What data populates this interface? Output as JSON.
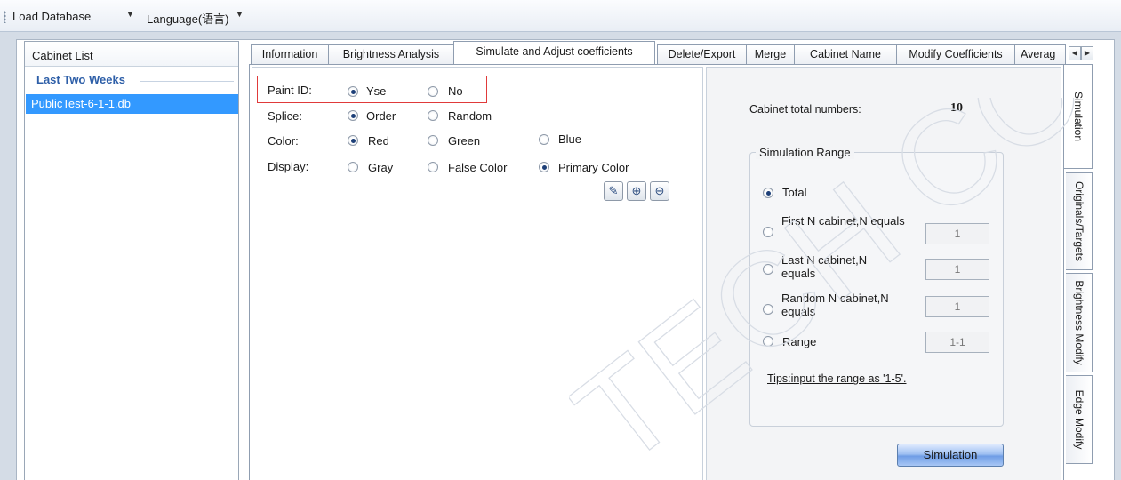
{
  "toolbar": {
    "load_database": "Load Database",
    "language": "Language(语言)"
  },
  "cabinet_list": {
    "header": "Cabinet List",
    "group": "Last Two Weeks",
    "items": [
      {
        "label": "PublicTest-6-1-1.db",
        "selected": true
      }
    ]
  },
  "tabs": [
    {
      "label": "Information"
    },
    {
      "label": "Brightness Analysis"
    },
    {
      "label": "Simulate and Adjust coefficients",
      "active": true
    },
    {
      "label": "Delete/Export"
    },
    {
      "label": "Merge"
    },
    {
      "label": "Cabinet Name"
    },
    {
      "label": "Modify Coefficients"
    },
    {
      "label": "Averag"
    }
  ],
  "options": {
    "paint_id": {
      "label": "Paint ID:",
      "choices": [
        "Yse",
        "No"
      ],
      "selected": "Yse"
    },
    "splice": {
      "label": "Splice:",
      "choices": [
        "Order",
        "Random"
      ],
      "selected": "Order"
    },
    "color": {
      "label": "Color:",
      "choices": [
        "Red",
        "Green",
        "Blue"
      ],
      "selected": "Red"
    },
    "display": {
      "label": "Display:",
      "choices": [
        "Gray",
        "False Color",
        "Primary Color"
      ],
      "selected": "Primary Color"
    },
    "icons": [
      "edit-icon",
      "zoom-in-icon",
      "zoom-out-icon"
    ]
  },
  "simulation": {
    "total_label": "Cabinet total numbers:",
    "total_value": "10",
    "range_title": "Simulation Range",
    "ranges": [
      {
        "label": "Total",
        "selected": true
      },
      {
        "label": "First N cabinet,N equals",
        "value": "1"
      },
      {
        "label": "Last N cabinet,N equals",
        "value": "1"
      },
      {
        "label": "Random N cabinet,N equals",
        "value": "1"
      },
      {
        "label": "Range",
        "value": "1-1"
      }
    ],
    "tips": "Tips:input the range as '1-5'.",
    "button": "Simulation"
  },
  "side_tabs": [
    {
      "label": "Simulation",
      "active": true
    },
    {
      "label": "Originals/Targets"
    },
    {
      "label": "Brightness Modify"
    },
    {
      "label": "Edge Modify"
    }
  ],
  "watermark": "TECH CO., LTD.",
  "colors": {
    "selection": "#3399ff",
    "highlight_border": "#e03a3a",
    "accent_text": "#2e5fa8"
  }
}
